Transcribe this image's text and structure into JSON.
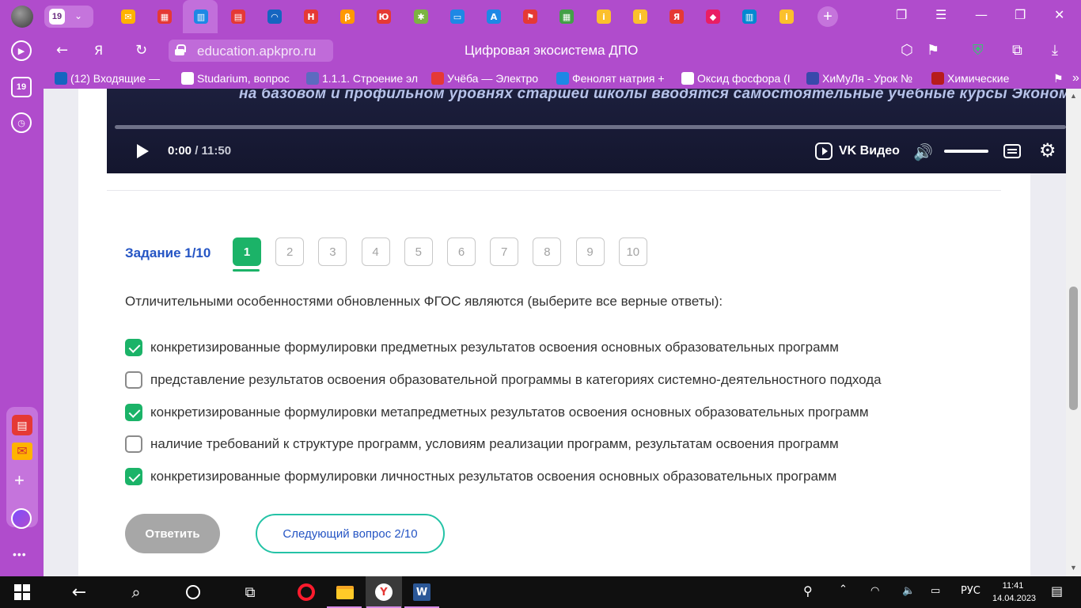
{
  "browser": {
    "tab_count": "19",
    "url": "education.apkpro.ru",
    "page_title": "Цифровая экосистема ДПО",
    "sidebar_badge": "19",
    "tabs": [
      {
        "icon": "mail-icon",
        "color": "#ffb300",
        "glyph": "✉"
      },
      {
        "icon": "windows-icon",
        "color": "#e53935",
        "glyph": "▦"
      },
      {
        "icon": "book-icon",
        "color": "#1e88e5",
        "glyph": "▥"
      },
      {
        "icon": "doc-red-icon",
        "color": "#e53935",
        "glyph": "▤"
      },
      {
        "icon": "swoosh-icon",
        "color": "#1565c0",
        "glyph": "◠"
      },
      {
        "icon": "n-icon",
        "color": "#e53935",
        "glyph": "Н"
      },
      {
        "icon": "b-icon",
        "color": "#ff9800",
        "glyph": "β"
      },
      {
        "icon": "bracket-icon",
        "color": "#e53935",
        "glyph": "Ю"
      },
      {
        "icon": "yandex-icon",
        "color": "#7cb342",
        "glyph": "✱"
      },
      {
        "icon": "chat-icon",
        "color": "#1e88e5",
        "glyph": "▭"
      },
      {
        "icon": "a-icon",
        "color": "#1e88e5",
        "glyph": "A"
      },
      {
        "icon": "flag-icon",
        "color": "#e53935",
        "glyph": "⚑"
      },
      {
        "icon": "grid-icon",
        "color": "#43a047",
        "glyph": "▦"
      },
      {
        "icon": "info-icon",
        "color": "#fbc02d",
        "glyph": "i"
      },
      {
        "icon": "info-icon",
        "color": "#fbc02d",
        "glyph": "i"
      },
      {
        "icon": "ya-icon",
        "color": "#e53935",
        "glyph": "Я"
      },
      {
        "icon": "heart-icon",
        "color": "#e91e63",
        "glyph": "◆"
      },
      {
        "icon": "book-icon",
        "color": "#0288d1",
        "glyph": "▥"
      },
      {
        "icon": "info-icon",
        "color": "#fbc02d",
        "glyph": "i"
      }
    ],
    "bookmarks": [
      {
        "label": "(12) Входящие — ",
        "color": "#1565c0"
      },
      {
        "label": "Studarium, вопрос",
        "color": "#ffffff"
      },
      {
        "label": "1.1.1. Строение эл",
        "color": "#5c6bc0"
      },
      {
        "label": "Учёба — Электро",
        "color": "#e53935"
      },
      {
        "label": "Фенолят натрия +",
        "color": "#1e88e5"
      },
      {
        "label": "Оксид фосфора (I",
        "color": "#ffffff"
      },
      {
        "label": "ХиМуЛя - Урок №",
        "color": "#3949ab"
      },
      {
        "label": "Химические",
        "color": "#b71c1c"
      }
    ]
  },
  "video": {
    "subtitle": "на базовом и профильном уровнях старшей школы вводятся самостоятельные учебные курсы Экономика и Право",
    "time_current": "0:00",
    "time_total": " / 11:50",
    "brand": "VK Видео",
    "progress": 0.0
  },
  "quiz": {
    "task_label": "Задание 1/10",
    "questions": [
      "1",
      "2",
      "3",
      "4",
      "5",
      "6",
      "7",
      "8",
      "9",
      "10"
    ],
    "active_question": "1",
    "question_text": "Отличительными особенностями обновленных ФГОС являются (выберите все верные ответы):",
    "options": [
      {
        "text": "конкретизированные формулировки предметных результатов освоения основных образовательных программ",
        "checked": true
      },
      {
        "text": "представление результатов освоения образовательной программы в категориях системно-деятельностного подхода",
        "checked": false
      },
      {
        "text": "конкретизированные формулировки метапредметных результатов освоения основных образовательных программ",
        "checked": true
      },
      {
        "text": "наличие требований к структуре программ, условиям реализации программ, результатам освоения программ",
        "checked": false
      },
      {
        "text": "конкретизированные формулировки личностных результатов освоения основных образовательных программ",
        "checked": true
      }
    ],
    "answer_button": "Ответить",
    "next_button": "Следующий вопрос 2/10"
  },
  "taskbar": {
    "lang": "РУС",
    "time": "11:41",
    "date": "14.04.2023"
  }
}
